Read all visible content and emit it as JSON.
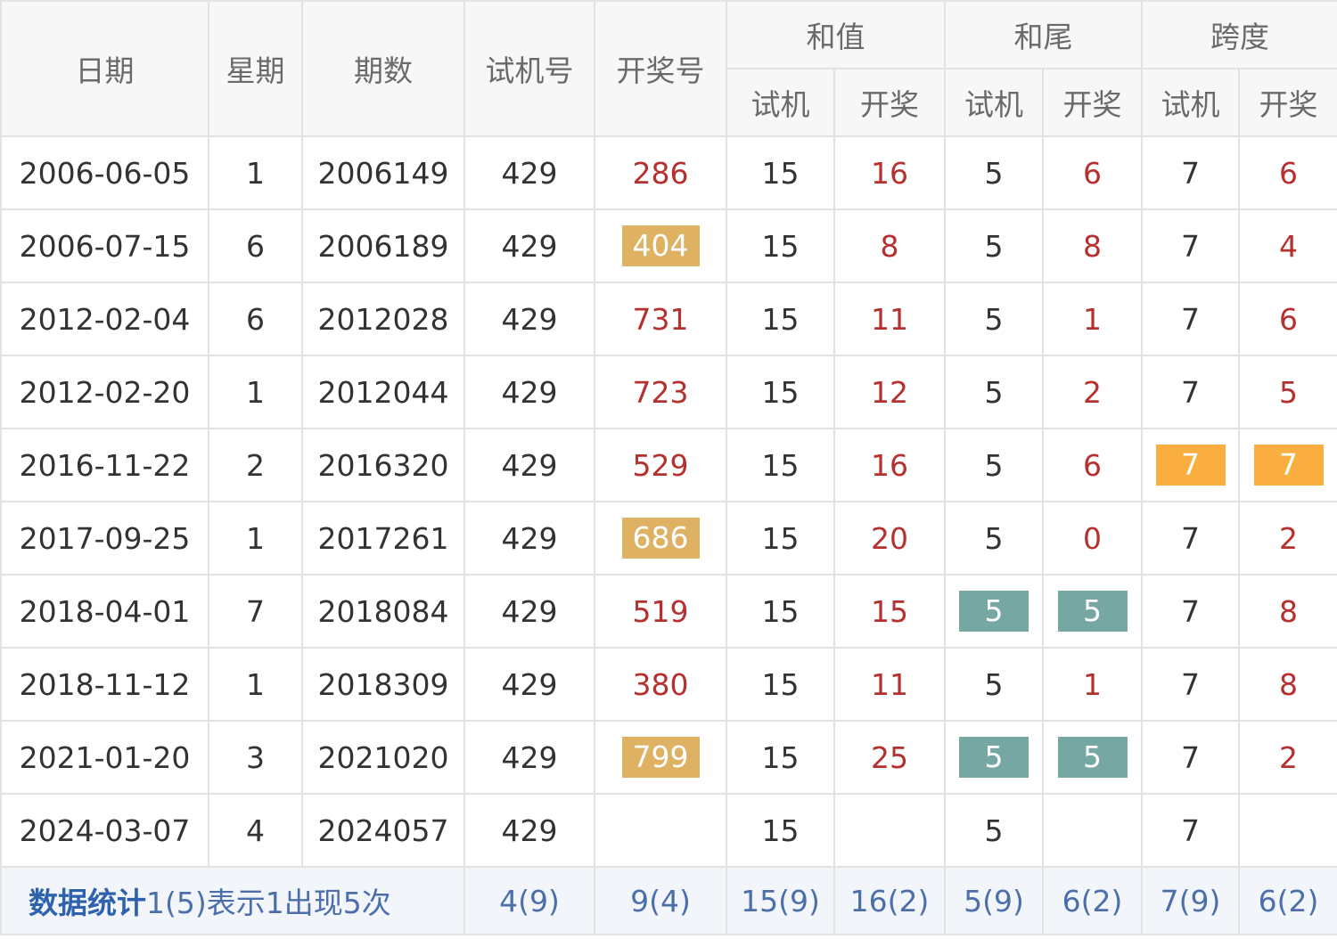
{
  "colors": {
    "border": "#e2e2e2",
    "header_bg": "#f7f7f7",
    "header_text": "#6a6a6a",
    "body_text": "#333333",
    "draw_red": "#b4312f",
    "hl_gold": "#dfb162",
    "hl_orange": "#f9ae3f",
    "hl_teal": "#77a7a3",
    "footer_bg": "#f2f6fa",
    "footer_text": "#4c6fab"
  },
  "header": {
    "date": "日期",
    "weekday": "星期",
    "issue": "期数",
    "trial_no": "试机号",
    "draw_no": "开奖号",
    "sum": "和值",
    "sum_tail": "和尾",
    "span": "跨度",
    "sub_trial": "试机",
    "sub_draw": "开奖"
  },
  "rows": [
    {
      "date": "2006-06-05",
      "weekday": "1",
      "issue": "2006149",
      "trial": "429",
      "draw": "286",
      "draw_hl": "",
      "sum_t": "15",
      "sum_d": "16",
      "tail_t": "5",
      "tail_t_hl": "",
      "tail_d": "6",
      "tail_d_hl": "",
      "span_t": "7",
      "span_t_hl": "",
      "span_d": "6",
      "span_d_hl": ""
    },
    {
      "date": "2006-07-15",
      "weekday": "6",
      "issue": "2006189",
      "trial": "429",
      "draw": "404",
      "draw_hl": "gold",
      "sum_t": "15",
      "sum_d": "8",
      "tail_t": "5",
      "tail_t_hl": "",
      "tail_d": "8",
      "tail_d_hl": "",
      "span_t": "7",
      "span_t_hl": "",
      "span_d": "4",
      "span_d_hl": ""
    },
    {
      "date": "2012-02-04",
      "weekday": "6",
      "issue": "2012028",
      "trial": "429",
      "draw": "731",
      "draw_hl": "",
      "sum_t": "15",
      "sum_d": "11",
      "tail_t": "5",
      "tail_t_hl": "",
      "tail_d": "1",
      "tail_d_hl": "",
      "span_t": "7",
      "span_t_hl": "",
      "span_d": "6",
      "span_d_hl": ""
    },
    {
      "date": "2012-02-20",
      "weekday": "1",
      "issue": "2012044",
      "trial": "429",
      "draw": "723",
      "draw_hl": "",
      "sum_t": "15",
      "sum_d": "12",
      "tail_t": "5",
      "tail_t_hl": "",
      "tail_d": "2",
      "tail_d_hl": "",
      "span_t": "7",
      "span_t_hl": "",
      "span_d": "5",
      "span_d_hl": ""
    },
    {
      "date": "2016-11-22",
      "weekday": "2",
      "issue": "2016320",
      "trial": "429",
      "draw": "529",
      "draw_hl": "",
      "sum_t": "15",
      "sum_d": "16",
      "tail_t": "5",
      "tail_t_hl": "",
      "tail_d": "6",
      "tail_d_hl": "",
      "span_t": "7",
      "span_t_hl": "orange",
      "span_d": "7",
      "span_d_hl": "orange"
    },
    {
      "date": "2017-09-25",
      "weekday": "1",
      "issue": "2017261",
      "trial": "429",
      "draw": "686",
      "draw_hl": "gold",
      "sum_t": "15",
      "sum_d": "20",
      "tail_t": "5",
      "tail_t_hl": "",
      "tail_d": "0",
      "tail_d_hl": "",
      "span_t": "7",
      "span_t_hl": "",
      "span_d": "2",
      "span_d_hl": ""
    },
    {
      "date": "2018-04-01",
      "weekday": "7",
      "issue": "2018084",
      "trial": "429",
      "draw": "519",
      "draw_hl": "",
      "sum_t": "15",
      "sum_d": "15",
      "tail_t": "5",
      "tail_t_hl": "teal",
      "tail_d": "5",
      "tail_d_hl": "teal",
      "span_t": "7",
      "span_t_hl": "",
      "span_d": "8",
      "span_d_hl": ""
    },
    {
      "date": "2018-11-12",
      "weekday": "1",
      "issue": "2018309",
      "trial": "429",
      "draw": "380",
      "draw_hl": "",
      "sum_t": "15",
      "sum_d": "11",
      "tail_t": "5",
      "tail_t_hl": "",
      "tail_d": "1",
      "tail_d_hl": "",
      "span_t": "7",
      "span_t_hl": "",
      "span_d": "8",
      "span_d_hl": ""
    },
    {
      "date": "2021-01-20",
      "weekday": "3",
      "issue": "2021020",
      "trial": "429",
      "draw": "799",
      "draw_hl": "gold",
      "sum_t": "15",
      "sum_d": "25",
      "tail_t": "5",
      "tail_t_hl": "teal",
      "tail_d": "5",
      "tail_d_hl": "teal",
      "span_t": "7",
      "span_t_hl": "",
      "span_d": "2",
      "span_d_hl": ""
    },
    {
      "date": "2024-03-07",
      "weekday": "4",
      "issue": "2024057",
      "trial": "429",
      "draw": "",
      "draw_hl": "",
      "sum_t": "15",
      "sum_d": "",
      "tail_t": "5",
      "tail_t_hl": "",
      "tail_d": "",
      "tail_d_hl": "",
      "span_t": "7",
      "span_t_hl": "",
      "span_d": "",
      "span_d_hl": ""
    }
  ],
  "footer": {
    "title": "数据统计",
    "note": "1(5)表示1出现5次",
    "trial": "4(9)",
    "draw": "9(4)",
    "sum_t": "15(9)",
    "sum_d": "16(2)",
    "tail_t": "5(9)",
    "tail_d": "6(2)",
    "span_t": "7(9)",
    "span_d": "6(2)"
  }
}
